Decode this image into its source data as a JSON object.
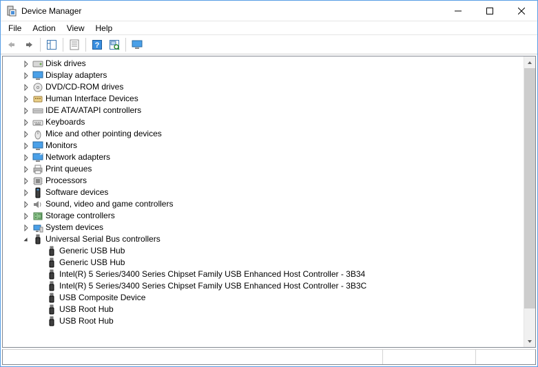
{
  "window": {
    "title": "Device Manager"
  },
  "menu": {
    "file": "File",
    "action": "Action",
    "view": "View",
    "help": "Help"
  },
  "tree": {
    "categories": [
      {
        "label": "Disk drives",
        "icon": "disk",
        "expanded": false
      },
      {
        "label": "Display adapters",
        "icon": "display",
        "expanded": false
      },
      {
        "label": "DVD/CD-ROM drives",
        "icon": "dvd",
        "expanded": false
      },
      {
        "label": "Human Interface Devices",
        "icon": "hid",
        "expanded": false
      },
      {
        "label": "IDE ATA/ATAPI controllers",
        "icon": "ide",
        "expanded": false
      },
      {
        "label": "Keyboards",
        "icon": "keyboard",
        "expanded": false
      },
      {
        "label": "Mice and other pointing devices",
        "icon": "mouse",
        "expanded": false
      },
      {
        "label": "Monitors",
        "icon": "monitor",
        "expanded": false
      },
      {
        "label": "Network adapters",
        "icon": "network",
        "expanded": false
      },
      {
        "label": "Print queues",
        "icon": "printer",
        "expanded": false
      },
      {
        "label": "Processors",
        "icon": "cpu",
        "expanded": false
      },
      {
        "label": "Software devices",
        "icon": "software",
        "expanded": false
      },
      {
        "label": "Sound, video and game controllers",
        "icon": "sound",
        "expanded": false
      },
      {
        "label": "Storage controllers",
        "icon": "storage",
        "expanded": false
      },
      {
        "label": "System devices",
        "icon": "system",
        "expanded": false
      },
      {
        "label": "Universal Serial Bus controllers",
        "icon": "usb",
        "expanded": true,
        "children": [
          {
            "label": "Generic USB Hub",
            "icon": "usb"
          },
          {
            "label": "Generic USB Hub",
            "icon": "usb"
          },
          {
            "label": "Intel(R) 5 Series/3400 Series Chipset Family USB Enhanced Host Controller - 3B34",
            "icon": "usb"
          },
          {
            "label": "Intel(R) 5 Series/3400 Series Chipset Family USB Enhanced Host Controller - 3B3C",
            "icon": "usb"
          },
          {
            "label": "USB Composite Device",
            "icon": "usb"
          },
          {
            "label": "USB Root Hub",
            "icon": "usb"
          },
          {
            "label": "USB Root Hub",
            "icon": "usb"
          }
        ]
      }
    ]
  }
}
